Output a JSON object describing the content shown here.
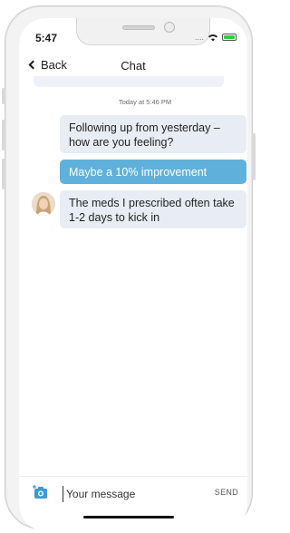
{
  "status_bar": {
    "time": "5:47",
    "signal_dots": "....",
    "wifi_icon": "wifi-icon",
    "battery_color": "#2ecc40"
  },
  "nav": {
    "back_label": "Back",
    "title": "Chat"
  },
  "conversation": {
    "timestamp": "Today at 5:46 PM",
    "messages": [
      {
        "direction": "incoming",
        "text": "Following up from yesterday – how are you feeling?"
      },
      {
        "direction": "outgoing",
        "text": "Maybe a 10% improvement"
      },
      {
        "direction": "incoming",
        "text": "The meds I prescribed often take 1-2 days to kick in"
      }
    ]
  },
  "composer": {
    "placeholder": "Your message",
    "send_label": "SEND",
    "camera_icon": "camera-icon"
  },
  "colors": {
    "incoming_bubble": "#e8edf5",
    "outgoing_bubble": "#5fb1db",
    "accent": "#3a9ad9"
  }
}
